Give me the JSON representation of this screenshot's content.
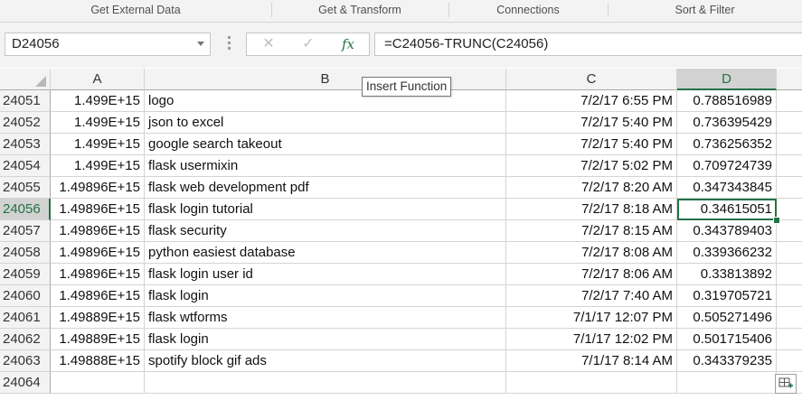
{
  "ribbon": {
    "groups": [
      "Get External Data",
      "Get & Transform",
      "Connections",
      "Sort & Filter"
    ]
  },
  "formula_bar": {
    "name_box": "D24056",
    "cancel_icon": "✕",
    "enter_icon": "✓",
    "fx_label": "fx",
    "formula": "=C24056-TRUNC(C24056)"
  },
  "tooltip": "Insert Function",
  "columns": [
    "A",
    "B",
    "C",
    "D"
  ],
  "active_column": "D",
  "active_row": "24056",
  "rows": [
    {
      "num": "24051",
      "a": "1.499E+15",
      "b": "logo",
      "c": "7/2/17 6:55 PM",
      "d": "0.788516989"
    },
    {
      "num": "24052",
      "a": "1.499E+15",
      "b": "json to excel",
      "c": "7/2/17 5:40 PM",
      "d": "0.736395429"
    },
    {
      "num": "24053",
      "a": "1.499E+15",
      "b": "google search takeout",
      "c": "7/2/17 5:40 PM",
      "d": "0.736256352"
    },
    {
      "num": "24054",
      "a": "1.499E+15",
      "b": "flask usermixin",
      "c": "7/2/17 5:02 PM",
      "d": "0.709724739"
    },
    {
      "num": "24055",
      "a": "1.49896E+15",
      "b": "flask web development pdf",
      "c": "7/2/17 8:20 AM",
      "d": "0.347343845"
    },
    {
      "num": "24056",
      "a": "1.49896E+15",
      "b": "flask login tutorial",
      "c": "7/2/17 8:18 AM",
      "d": "0.34615051"
    },
    {
      "num": "24057",
      "a": "1.49896E+15",
      "b": "flask security",
      "c": "7/2/17 8:15 AM",
      "d": "0.343789403"
    },
    {
      "num": "24058",
      "a": "1.49896E+15",
      "b": "python easiest database",
      "c": "7/2/17 8:08 AM",
      "d": "0.339366232"
    },
    {
      "num": "24059",
      "a": "1.49896E+15",
      "b": "flask login user id",
      "c": "7/2/17 8:06 AM",
      "d": "0.33813892"
    },
    {
      "num": "24060",
      "a": "1.49896E+15",
      "b": "flask login",
      "c": "7/2/17 7:40 AM",
      "d": "0.319705721"
    },
    {
      "num": "24061",
      "a": "1.49889E+15",
      "b": "flask wtforms",
      "c": "7/1/17 12:07 PM",
      "d": "0.505271496"
    },
    {
      "num": "24062",
      "a": "1.49889E+15",
      "b": "flask login",
      "c": "7/1/17 12:02 PM",
      "d": "0.501715406"
    },
    {
      "num": "24063",
      "a": "1.49888E+15",
      "b": "spotify block gif ads",
      "c": "7/1/17 8:14 AM",
      "d": "0.343379235"
    },
    {
      "num": "24064",
      "a": "",
      "b": "",
      "c": "",
      "d": ""
    }
  ]
}
